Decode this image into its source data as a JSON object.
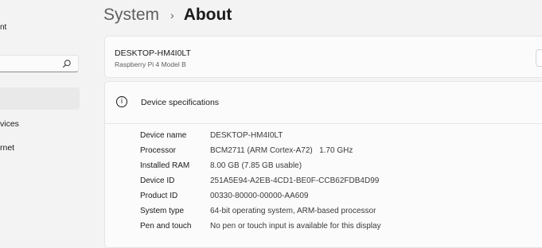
{
  "sidebar": {
    "account_fragment": "nt",
    "search": {
      "value": "",
      "placeholder": ""
    },
    "items": [
      {
        "label": "vices"
      },
      {
        "label": "rnet"
      }
    ]
  },
  "header": {
    "parent": "System",
    "separator": "›",
    "current": "About"
  },
  "device": {
    "name": "DESKTOP-HM4I0LT",
    "model": "Raspberry Pi 4 Model B"
  },
  "specs": {
    "title": "Device specifications",
    "rows": [
      {
        "label": "Device name",
        "value": "DESKTOP-HM4I0LT"
      },
      {
        "label": "Processor",
        "value": "BCM2711 (ARM Cortex-A72)   1.70 GHz"
      },
      {
        "label": "Installed RAM",
        "value": "8.00 GB (7.85 GB usable)"
      },
      {
        "label": "Device ID",
        "value": "251A5E94-A2EB-4CD1-BE0F-CCB62FDB4D99"
      },
      {
        "label": "Product ID",
        "value": "00330-80000-00000-AA609"
      },
      {
        "label": "System type",
        "value": "64-bit operating system, ARM-based processor"
      },
      {
        "label": "Pen and touch",
        "value": "No pen or touch input is available for this display"
      }
    ]
  },
  "icons": {
    "search": "search-icon",
    "info": "info-icon"
  }
}
